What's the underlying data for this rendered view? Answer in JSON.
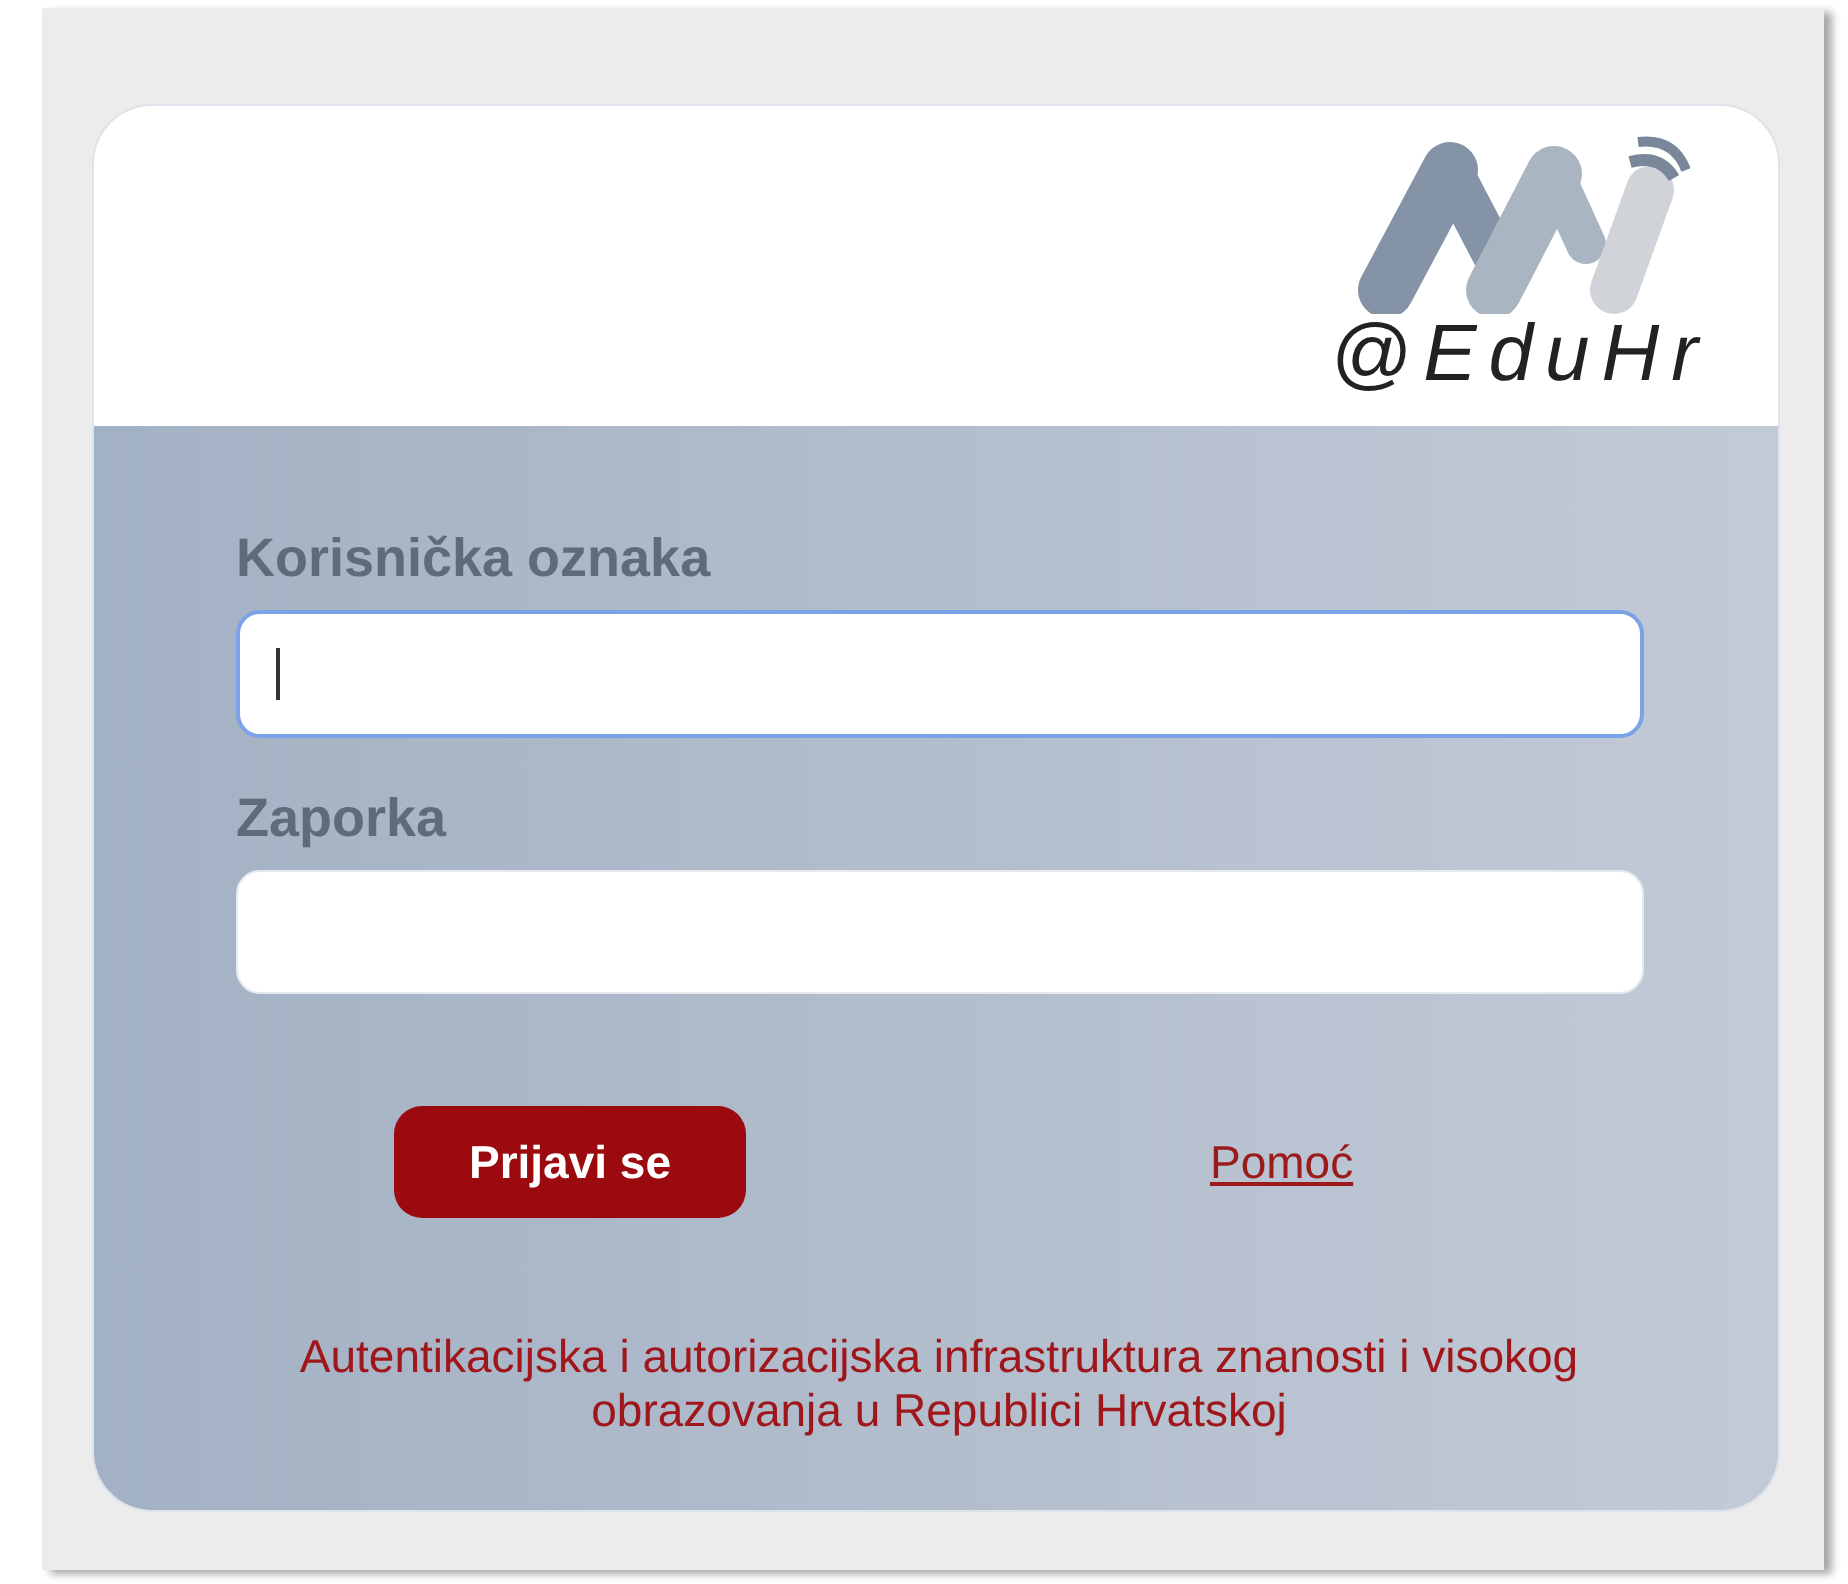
{
  "logo": {
    "text": "@EduHr"
  },
  "form": {
    "fields": [
      {
        "label": "Korisnička oznaka",
        "focused": true
      },
      {
        "label": "Zaporka",
        "focused": false
      }
    ],
    "submit": "Prijavi se",
    "help_link": "Pomoć"
  },
  "footer": "Autentikacijska i autorizacijska infrastruktura znanosti i visokog obrazovanja u Republici Hrvatskoj"
}
